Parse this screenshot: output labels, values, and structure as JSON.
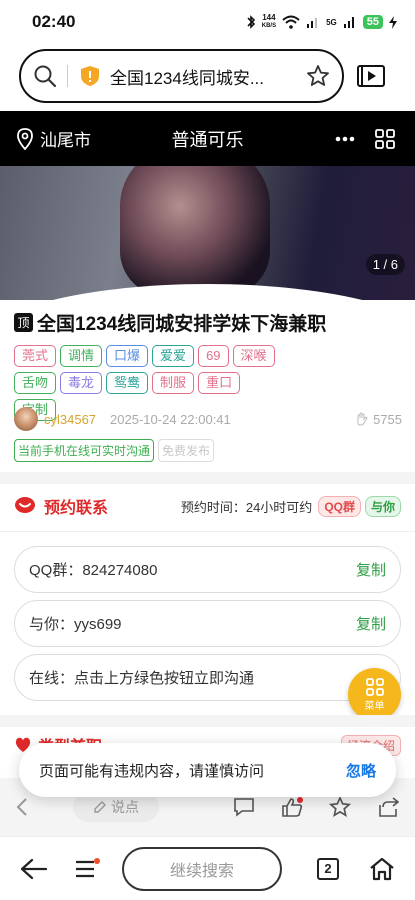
{
  "status": {
    "time": "02:40",
    "net_speed_value": "144",
    "net_speed_unit": "KB/S",
    "battery": "55",
    "signal_label": "5G"
  },
  "browser": {
    "url_title": "全国1234线同城安...",
    "tab_count": "2",
    "continue_search": "继续搜索"
  },
  "nav": {
    "city": "汕尾市",
    "title": "普通可乐"
  },
  "hero": {
    "counter": "1 / 6"
  },
  "post": {
    "badge": "顶",
    "title": "全国1234线同城安排学妹下海兼职",
    "tags": [
      {
        "label": "莞式",
        "color": "#e2708a"
      },
      {
        "label": "调情",
        "color": "#43b05c"
      },
      {
        "label": "口爆",
        "color": "#5b8de0"
      },
      {
        "label": "爱爱",
        "color": "#2aa598"
      },
      {
        "label": "69",
        "color": "#e2708a"
      },
      {
        "label": "深喉",
        "color": "#e2708a"
      },
      {
        "label": "舌吻",
        "color": "#43b05c"
      },
      {
        "label": "毒龙",
        "color": "#8d7be0"
      },
      {
        "label": "鸳鸯",
        "color": "#2aa598"
      },
      {
        "label": "制服",
        "color": "#e2708a"
      },
      {
        "label": "重口",
        "color": "#e2708a"
      },
      {
        "label": "定制",
        "color": "#43b05c"
      }
    ],
    "author": "cyl34567",
    "time": "2025-10-24 22:00:41",
    "views": "5755",
    "chip_online": "当前手机在线可实时沟通",
    "chip_free": "免费发布"
  },
  "appointment": {
    "section_title": "预约联系",
    "time_label": "预约时间：24小时可约",
    "pill_qq": "QQ群",
    "pill_yuni": "与你",
    "rows": [
      {
        "text": "QQ群：824274080",
        "action": "复制"
      },
      {
        "text": "与你：yys699",
        "action": "复制"
      },
      {
        "text": "在线：点击上方绿色按钮立即沟通",
        "action": ""
      }
    ]
  },
  "fab": {
    "label": "菜单"
  },
  "section2": {
    "title": "类型兼职",
    "tag": "经济介绍"
  },
  "comment_bar": {
    "placeholder": "说点"
  },
  "toast": {
    "text": "页面可能有违规内容，请谨慎访问",
    "ignore": "忽略"
  },
  "colors": {
    "accent_red": "#e02a2a",
    "green": "#2e9e43",
    "fab": "#f6b71d"
  }
}
